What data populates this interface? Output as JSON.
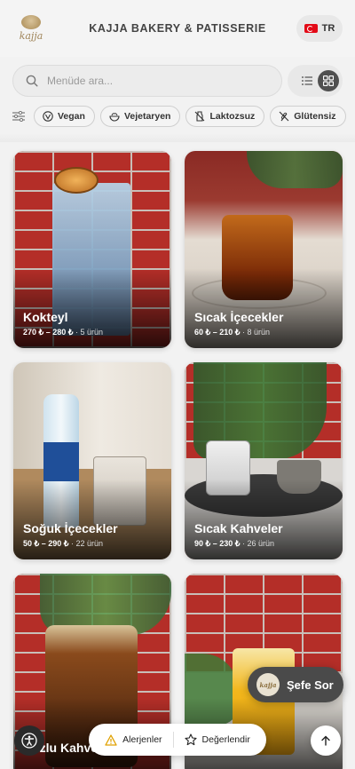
{
  "header": {
    "logo_text": "kajja",
    "brand": "KAJJA BAKERY & PATISSERIE",
    "language": "TR"
  },
  "search": {
    "placeholder": "Menüde ara..."
  },
  "view": {
    "list_icon": "list-icon",
    "grid_icon": "grid-icon",
    "active": "grid"
  },
  "filters": [
    {
      "label": "Vegan",
      "icon": "vegan-icon"
    },
    {
      "label": "Vejetaryen",
      "icon": "vegetarian-icon"
    },
    {
      "label": "Laktozsuz",
      "icon": "lactose-free-icon"
    },
    {
      "label": "Glütensiz",
      "icon": "gluten-free-icon"
    }
  ],
  "categories": [
    {
      "title": "Kokteyl",
      "price": "270 ₺ – 280 ₺",
      "count": "· 5 ürün"
    },
    {
      "title": "Sıcak İçecekler",
      "price": "60 ₺ – 210 ₺",
      "count": "· 8 ürün"
    },
    {
      "title": "Soğuk İçecekler",
      "price": "50 ₺ – 290 ₺",
      "count": "· 22 ürün"
    },
    {
      "title": "Sıcak Kahveler",
      "price": "90 ₺ – 230 ₺",
      "count": "· 26 ürün"
    },
    {
      "title": "Buzlu Kahveler",
      "price": "",
      "count": ""
    },
    {
      "title": "",
      "price": "",
      "count": ""
    }
  ],
  "bottom": {
    "allergens": "Alerjenler",
    "rate": "Değerlendir",
    "chef": "Şefe Sor",
    "chef_avatar": "kajja"
  },
  "colors": {
    "brick": "#b42e28",
    "accent_dark": "#4a4a4a",
    "warning": "#e0a100"
  }
}
